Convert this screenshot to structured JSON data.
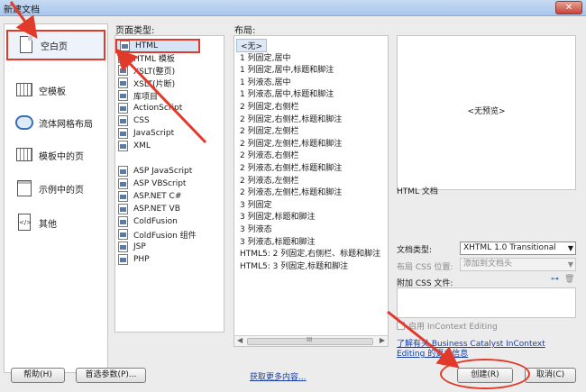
{
  "window": {
    "title": "新建文档",
    "close_label": "✕"
  },
  "categories": [
    {
      "label": "空白页",
      "icon": "blank-page-icon",
      "selected": true
    },
    {
      "label": "空模板",
      "icon": "blank-template-icon"
    },
    {
      "label": "流体网格布局",
      "icon": "fluid-grid-icon"
    },
    {
      "label": "模板中的页",
      "icon": "template-page-icon"
    },
    {
      "label": "示例中的页",
      "icon": "sample-page-icon"
    },
    {
      "label": "其他",
      "icon": "other-code-icon"
    }
  ],
  "page_type": {
    "header": "页面类型:",
    "items": [
      "HTML",
      "HTML 模板",
      "XSLT(整页)",
      "XSLT(片断)",
      "库项目",
      "ActionScript",
      "CSS",
      "JavaScript",
      "XML",
      "ASP JavaScript",
      "ASP VBScript",
      "ASP.NET C#",
      "ASP.NET VB",
      "ColdFusion",
      "ColdFusion 组件",
      "JSP",
      "PHP"
    ],
    "selected": "HTML"
  },
  "layout": {
    "header": "布局:",
    "items": [
      "<无>",
      "1 列固定,居中",
      "1 列固定,居中,标题和脚注",
      "1 列液态,居中",
      "1 列液态,居中,标题和脚注",
      "2 列固定,右侧栏",
      "2 列固定,右侧栏,标题和脚注",
      "2 列固定,左侧栏",
      "2 列固定,左侧栏,标题和脚注",
      "2 列液态,右侧栏",
      "2 列液态,右侧栏,标题和脚注",
      "2 列液态,左侧栏",
      "2 列液态,左侧栏,标题和脚注",
      "3 列固定",
      "3 列固定,标题和脚注",
      "3 列液态",
      "3 列液态,标题和脚注",
      "HTML5: 2 列固定,右侧栏、标题和脚注",
      "HTML5: 3 列固定,标题和脚注"
    ],
    "scroll_label": "III",
    "scroll_left": "◀",
    "scroll_right": "▶"
  },
  "preview": {
    "placeholder": "<无预览>",
    "doc_label": "HTML 文档"
  },
  "doctype": {
    "label": "文档类型:",
    "value": "XHTML 1.0 Transitional"
  },
  "layout_css": {
    "label": "布局 CSS 位置:",
    "value": "添加到文档头"
  },
  "attach_css": {
    "label": "附加 CSS 文件:"
  },
  "incontext": {
    "label": "启用 InContext Editing"
  },
  "learn_more": {
    "line1": "了解有关 Business Catalyst InContext",
    "line2": "Editing 的更多信息"
  },
  "buttons": {
    "help": "帮助(H)",
    "prefs": "首选参数(P)...",
    "more": "获取更多内容...",
    "create": "创建(R)",
    "cancel": "取消(C)"
  }
}
